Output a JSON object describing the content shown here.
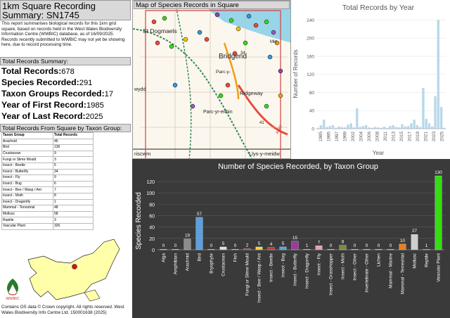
{
  "left": {
    "title": "1km Square Recording Summary: SN1745",
    "intro": "This report summarises biological records for this 1km grid square, based on records held in the West Wales Biodiversity Information Centre (WWBIC) database, as of 16/09/2025. Records recently submitted to WWBIC may not yet be showing here, due to record processing time.",
    "summary_header": "Total Records Summary:",
    "stats": [
      {
        "label": "Total Records:",
        "value": "678"
      },
      {
        "label": "Species Recorded:",
        "value": "291"
      },
      {
        "label": "Taxon Groups Recorded:",
        "value": "17"
      },
      {
        "label": "Year of First Record:",
        "value": "1985"
      },
      {
        "label": "Year of Last Record:",
        "value": "2025"
      }
    ],
    "taxon_header": "Total Records From Square by Taxon Group:",
    "table_headers": [
      "Taxon Group",
      "Total Records"
    ],
    "table_rows": [
      [
        "Arachnid",
        "46"
      ],
      [
        "Bird",
        "136"
      ],
      [
        "Crustacean",
        "9"
      ],
      [
        "Fungi or Slime Mould",
        "3"
      ],
      [
        "Insect - Beetle",
        "5"
      ],
      [
        "Insect - Butterfly",
        "34"
      ],
      [
        "Insect - Fly",
        "9"
      ],
      [
        "Insect - Bug",
        "6"
      ],
      [
        "Insect - Bee / Wasp / Ant",
        "7"
      ],
      [
        "Insect - Moth",
        "8"
      ],
      [
        "Insect - Dragonfly",
        "1"
      ],
      [
        "Mammal - Terrestrial",
        "48"
      ],
      [
        "Mollusc",
        "58"
      ],
      [
        "Reptile",
        "3"
      ],
      [
        "Vascular Plant",
        "326"
      ]
    ],
    "logo_text": "WWBIC",
    "footer": "Contains OS data © Crown copyright. All rights reserved. West Wales Biodiversity Info Centre Ltd. 150001638 (2025)"
  },
  "map": {
    "title": "Map of Species Records in Square",
    "labels": [
      "St Dogmaels",
      "Bridgend",
      "Parc-y-",
      "Ridgeway",
      "Parc-yr-eithin",
      "Llys-y-meidw",
      "riscwm",
      "wydd",
      "A487",
      "Mkt",
      "41",
      "34"
    ]
  },
  "colors": {
    "year_bar": "#b9d9ea",
    "taxon_bg": "#3a3a3a",
    "accent_green": "#33dd11"
  },
  "chart_data": [
    {
      "type": "bar",
      "title": "Total Records by Year",
      "xlabel": "Year",
      "ylabel": "Number of Records",
      "ylim": [
        0,
        250
      ],
      "yticks": [
        0,
        40,
        80,
        120,
        160,
        200,
        240
      ],
      "xtick_labels": [
        "1985",
        "1995",
        "1997",
        "1999",
        "2002",
        "2004",
        "2006",
        "2008",
        "2011",
        "2013",
        "2015",
        "2017",
        "2019",
        "2021",
        "2023",
        "2025"
      ],
      "categories": [
        "1985",
        "1986",
        "1987",
        "1988",
        "1989",
        "1990",
        "1991",
        "1992",
        "1993",
        "1994",
        "1995",
        "1996",
        "1997",
        "1998",
        "1999",
        "2000",
        "2001",
        "2002",
        "2003",
        "2004",
        "2005",
        "2006",
        "2007",
        "2008",
        "2009",
        "2010",
        "2011",
        "2012",
        "2013",
        "2014",
        "2015",
        "2016",
        "2017",
        "2018",
        "2019",
        "2020",
        "2021",
        "2022",
        "2023",
        "2024",
        "2025"
      ],
      "values": [
        2,
        8,
        20,
        4,
        6,
        8,
        2,
        5,
        4,
        3,
        9,
        12,
        3,
        45,
        4,
        6,
        8,
        3,
        2,
        4,
        3,
        2,
        5,
        2,
        6,
        8,
        4,
        3,
        10,
        5,
        6,
        12,
        20,
        8,
        4,
        90,
        22,
        12,
        5,
        72,
        240,
        48,
        2
      ]
    },
    {
      "type": "bar",
      "title": "Number of Species Recorded, by Taxon Group",
      "ylabel": "Species Recorded",
      "ylim": [
        0,
        130
      ],
      "yticks": [
        0,
        20,
        40,
        60,
        80,
        100,
        120
      ],
      "categories": [
        "Alga",
        "Amphibian",
        "Arachnid",
        "Bird",
        "Bryophyte",
        "Crustacean",
        "Fish",
        "Fungi or Slime Mould",
        "Insect - Bee / Wasp / Ant",
        "Insect - Beetle",
        "Insect - Bug",
        "Insect - Butterfly",
        "Insect - Dragonfly",
        "Insect - Fly",
        "Insect - Grasshopper",
        "Insect - Moth",
        "Insect - Other",
        "Invertebrate - Other",
        "Lichen",
        "Mammal - Marine",
        "Mammal - Terrestrial",
        "Mollusc",
        "Reptile",
        "Vascular Plant"
      ],
      "values": [
        0,
        0,
        19,
        57,
        0,
        5,
        0,
        2,
        5,
        4,
        5,
        15,
        1,
        7,
        0,
        8,
        0,
        0,
        0,
        0,
        10,
        27,
        1,
        130
      ],
      "colors": [
        "#888888",
        "#888888",
        "#8c8c8c",
        "#5aa0e0",
        "#888888",
        "#dddddd",
        "#888888",
        "#7a2a7a",
        "#e8d840",
        "#c0392b",
        "#4aa3df",
        "#9b3b9b",
        "#2e86c1",
        "#e8a0b0",
        "#888888",
        "#7a8a3a",
        "#888888",
        "#888888",
        "#888888",
        "#888888",
        "#e67e22",
        "#cfcfcf",
        "#444444",
        "#33dd11"
      ]
    }
  ]
}
